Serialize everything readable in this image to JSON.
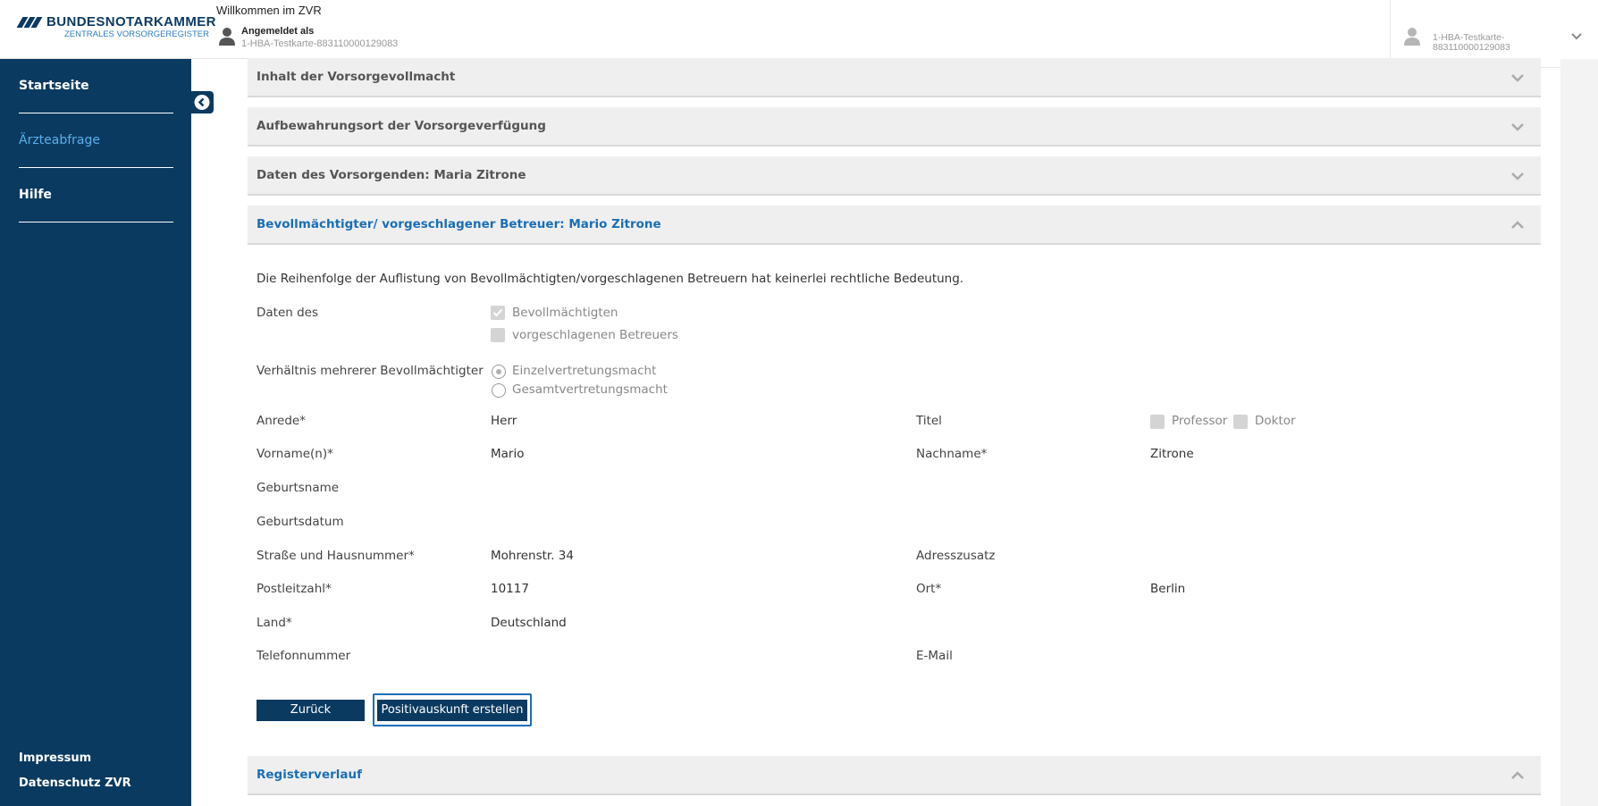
{
  "header": {
    "brand": "BUNDESNOTARKAMMER",
    "brand_sub": "ZENTRALES VORSORGEREGISTER",
    "welcome": "Willkommen im ZVR",
    "logged_in_label": "Angemeldet als",
    "logged_in_card": "1-HBA-Testkarte-883110000129083",
    "user_menu_line1": "1-HBA-Testkarte-",
    "user_menu_line2": "883110000129083",
    "icons": [
      "user-icon",
      "chevron-down-icon"
    ]
  },
  "sidebar": {
    "items": [
      {
        "label": "Startseite",
        "active": false
      },
      {
        "label": "Ärzteabfrage",
        "active": true
      },
      {
        "label": "Hilfe",
        "active": false
      }
    ],
    "footer": [
      "Impressum",
      "Datenschutz ZVR"
    ],
    "collapse_icon": "chevron-left-circle-icon",
    "colors": {
      "bg": "#0b3a60",
      "active": "#58b2ec"
    }
  },
  "accordions": [
    {
      "title": "Inhalt der Vorsorgevollmacht",
      "open": false
    },
    {
      "title": "Aufbewahrungsort der Vorsorgeverfügung",
      "open": false
    },
    {
      "title": "Daten des Vorsorgenden: Maria Zitrone",
      "open": false
    },
    {
      "title": "Bevollmächtigter/ vorgeschlagener Betreuer: Mario Zitrone",
      "open": true
    },
    {
      "title": "Registerverlauf",
      "open": true
    }
  ],
  "details": {
    "note": "Die Reihenfolge der Auflistung von Bevollmächtigten/vorgeschlagenen Betreuern hat keinerlei rechtliche Bedeutung.",
    "daten_des_label": "Daten des",
    "daten_des_options": [
      {
        "label": "Bevollmächtigten",
        "checked": true
      },
      {
        "label": "vorgeschlagenen Betreuers",
        "checked": false
      }
    ],
    "verhaeltnis_label": "Verhältnis mehrerer Bevollmächtigter",
    "verhaeltnis_options": [
      {
        "label": "Einzelvertretungsmacht",
        "selected": true
      },
      {
        "label": "Gesamtvertretungsmacht",
        "selected": false
      }
    ],
    "anrede_label": "Anrede*",
    "anrede_value": "Herr",
    "titel_label": "Titel",
    "titel_options": [
      "Professor",
      "Doktor"
    ],
    "vorname_label": "Vorname(n)*",
    "vorname_value": "Mario",
    "nachname_label": "Nachname*",
    "nachname_value": "Zitrone",
    "geburtsname_label": "Geburtsname",
    "geburtsdatum_label": "Geburtsdatum",
    "strasse_label": "Straße und Hausnummer*",
    "strasse_value": "Mohrenstr. 34",
    "adresszusatz_label": "Adresszusatz",
    "plz_label": "Postleitzahl*",
    "plz_value": "10117",
    "ort_label": "Ort*",
    "ort_value": "Berlin",
    "land_label": "Land*",
    "land_value": "Deutschland",
    "telefon_label": "Telefonnummer",
    "email_label": "E-Mail"
  },
  "buttons": {
    "back": "Zurück",
    "create": "Positivauskunft erstellen"
  }
}
